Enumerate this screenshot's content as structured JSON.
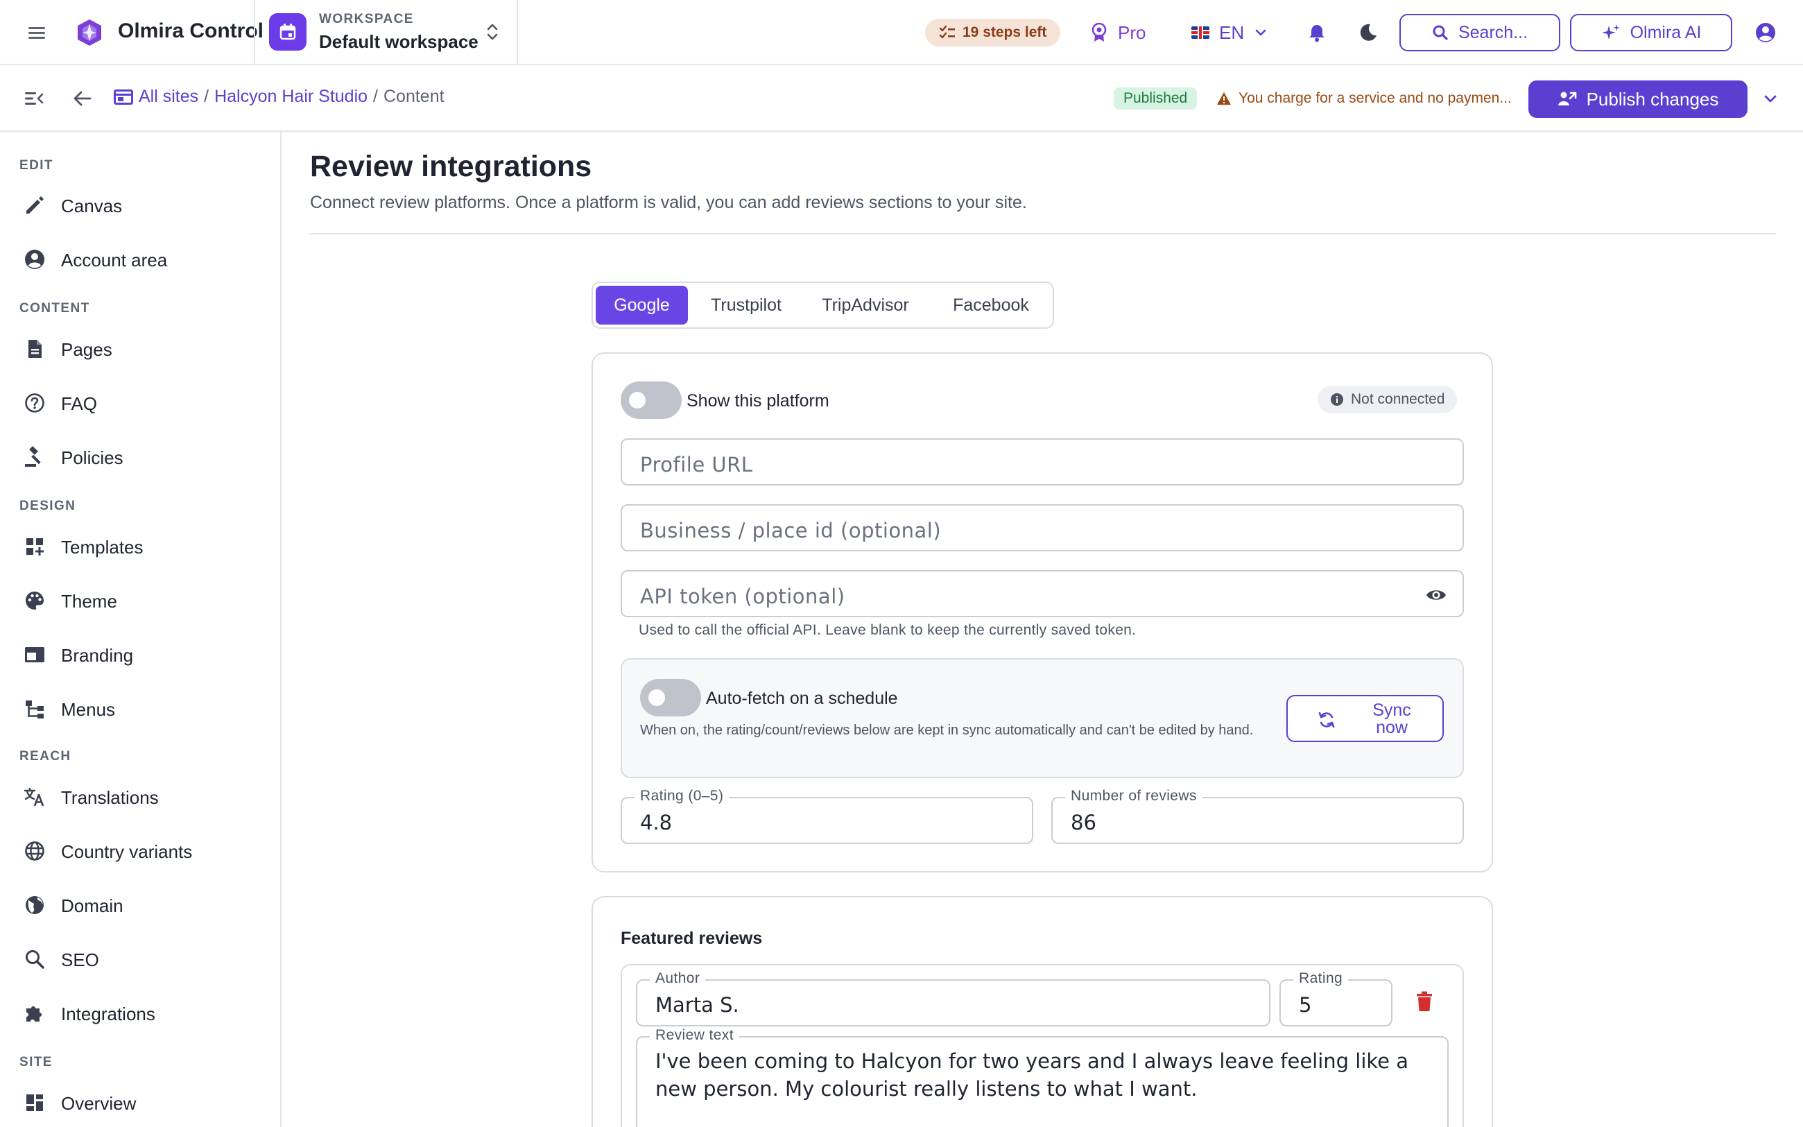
{
  "app": {
    "name": "Olmira Control"
  },
  "workspace": {
    "caption": "WORKSPACE",
    "name": "Default workspace"
  },
  "header": {
    "steps_left": "19 steps left",
    "plan": "Pro",
    "language": "EN",
    "search_label": "Search...",
    "ai_label": "Olmira AI"
  },
  "subbar": {
    "breadcrumb": {
      "all_sites": "All sites",
      "sep1": "/",
      "site": "Halcyon Hair Studio",
      "sep2": "/",
      "current": "Content"
    },
    "status": "Published",
    "warning": "You charge for a service and no paymen...",
    "publish_label": "Publish changes"
  },
  "sidebar": {
    "sections": [
      {
        "title": "EDIT",
        "items": [
          {
            "label": "Canvas",
            "icon": "pencil-icon"
          },
          {
            "label": "Account area",
            "icon": "account-circle-icon"
          }
        ]
      },
      {
        "title": "CONTENT",
        "items": [
          {
            "label": "Pages",
            "icon": "document-icon"
          },
          {
            "label": "FAQ",
            "icon": "help-circle-icon"
          },
          {
            "label": "Policies",
            "icon": "gavel-icon"
          }
        ]
      },
      {
        "title": "DESIGN",
        "items": [
          {
            "label": "Templates",
            "icon": "dashboard-add-icon"
          },
          {
            "label": "Theme",
            "icon": "palette-icon"
          },
          {
            "label": "Branding",
            "icon": "branding-icon"
          },
          {
            "label": "Menus",
            "icon": "tree-icon"
          }
        ]
      },
      {
        "title": "REACH",
        "items": [
          {
            "label": "Translations",
            "icon": "translate-icon"
          },
          {
            "label": "Country variants",
            "icon": "globe-icon"
          },
          {
            "label": "Domain",
            "icon": "public-icon"
          },
          {
            "label": "SEO",
            "icon": "search-icon"
          },
          {
            "label": "Integrations",
            "icon": "puzzle-icon"
          }
        ]
      },
      {
        "title": "SITE",
        "items": [
          {
            "label": "Overview",
            "icon": "dashboard-icon"
          }
        ]
      }
    ]
  },
  "page": {
    "title": "Review integrations",
    "description": "Connect review platforms. Once a platform is valid, you can add reviews sections to your site."
  },
  "tabs": [
    {
      "label": "Google",
      "active": true
    },
    {
      "label": "Trustpilot",
      "active": false
    },
    {
      "label": "TripAdvisor",
      "active": false
    },
    {
      "label": "Facebook",
      "active": false
    }
  ],
  "platform": {
    "show_label": "Show this platform",
    "show_enabled": false,
    "connection_status": "Not connected",
    "profile_url_placeholder": "Profile URL",
    "place_id_placeholder": "Business / place id (optional)",
    "api_token_placeholder": "API token (optional)",
    "api_token_help": "Used to call the official API. Leave blank to keep the currently saved token.",
    "autofetch_label": "Auto-fetch on a schedule",
    "autofetch_enabled": false,
    "autofetch_help": "When on, the rating/count/reviews below are kept in sync automatically and can't be edited by hand.",
    "sync_label": "Sync now",
    "rating_label": "Rating (0–5)",
    "rating_value": "4.8",
    "count_label": "Number of reviews",
    "count_value": "86"
  },
  "featured": {
    "title": "Featured reviews",
    "reviews": [
      {
        "author_label": "Author",
        "author": "Marta S.",
        "rating_label": "Rating",
        "rating": "5",
        "text_label": "Review text",
        "text": "I've been coming to Halcyon for two years and I always leave feeling like a new person. My colourist really listens to what I want."
      }
    ]
  },
  "colors": {
    "accent": "#5b3fd0",
    "tab_active": "#6a45e6",
    "warning": "#9a4a12",
    "success_bg": "#d7f3e1",
    "danger": "#d32f2f"
  }
}
